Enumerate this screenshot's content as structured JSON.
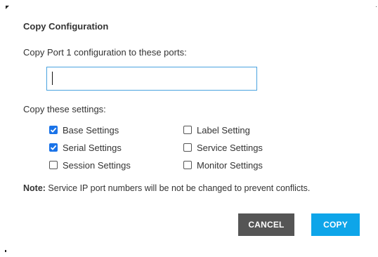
{
  "dialog": {
    "title": "Copy Configuration",
    "subtitle": "Copy Port 1 configuration to these ports:",
    "port_input": {
      "value": "",
      "placeholder": ""
    },
    "settings_label": "Copy these settings:",
    "options": [
      {
        "label": "Base Settings",
        "checked": true
      },
      {
        "label": "Serial Settings",
        "checked": true
      },
      {
        "label": "Session Settings",
        "checked": false
      },
      {
        "label": "Label Setting",
        "checked": false
      },
      {
        "label": "Service Settings",
        "checked": false
      },
      {
        "label": "Monitor Settings",
        "checked": false
      }
    ],
    "note_prefix": "Note:",
    "note_text": " Service IP port numbers will be not be changed to prevent conflicts.",
    "cancel_label": "CANCEL",
    "copy_label": "COPY"
  },
  "colors": {
    "accent": "#0ea5e9",
    "checkbox_checked": "#1a73e8",
    "cancel_bg": "#555555",
    "input_border": "#4aa3df"
  }
}
